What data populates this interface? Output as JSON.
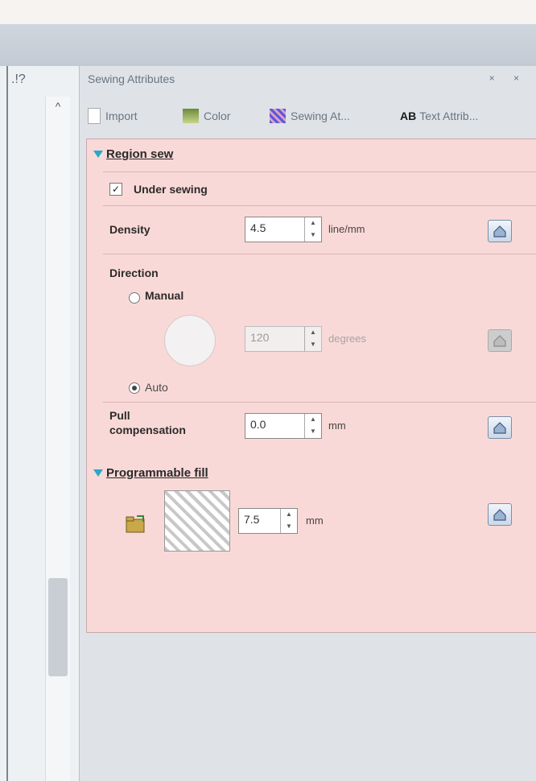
{
  "window": {
    "left_mark": ".!?"
  },
  "panel": {
    "title": "Sewing Attributes",
    "controls": "× ×",
    "tabs": [
      {
        "label": "Import",
        "icon": "import-icon"
      },
      {
        "label": "Color",
        "icon": "color-icon"
      },
      {
        "label": "Sewing At...",
        "icon": "sewing-attributes-icon"
      },
      {
        "label": "Text Attrib...",
        "icon": "text-attributes-icon",
        "prefix": "AB"
      }
    ]
  },
  "region_sew": {
    "header": "Region sew",
    "under_sewing": {
      "label": "Under sewing",
      "checked": true
    },
    "density": {
      "label": "Density",
      "value": "4.5",
      "unit": "line/mm"
    },
    "direction": {
      "label": "Direction",
      "manual_label": "Manual",
      "auto_label": "Auto",
      "selected": "Auto",
      "value": "120",
      "unit": "degrees"
    },
    "pull_compensation": {
      "label_line1": "Pull",
      "label_line2": "compensation",
      "value": "0.0",
      "unit": "mm"
    }
  },
  "programmable_fill": {
    "header": "Programmable fill",
    "value": "7.5",
    "unit": "mm"
  },
  "colors": {
    "content_bg": "#f9d9d7",
    "accent": "#2aa8c8",
    "panel_bg": "#dfe3e8"
  }
}
